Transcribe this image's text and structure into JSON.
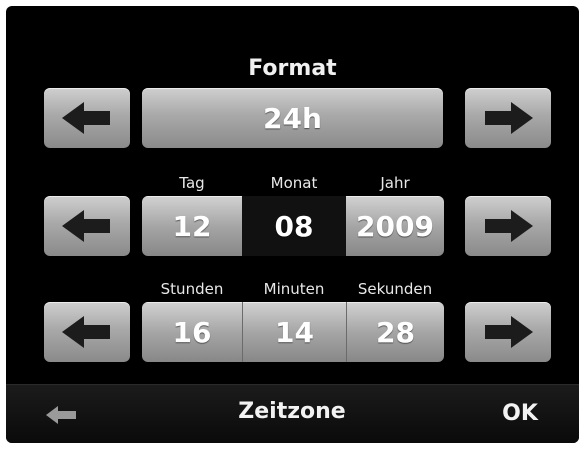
{
  "format": {
    "title": "Format",
    "value": "24h"
  },
  "date": {
    "labels": [
      "Tag",
      "Monat",
      "Jahr"
    ],
    "values": [
      "12",
      "08",
      "2009"
    ],
    "selected": "Monat"
  },
  "time": {
    "labels": [
      "Stunden",
      "Minuten",
      "Sekunden"
    ],
    "values": [
      "16",
      "14",
      "28"
    ]
  },
  "bottom": {
    "back_icon": "back-arrow-icon",
    "zeitzone_label": "Zeitzone",
    "ok_label": "OK"
  },
  "icons": {
    "left": "left-arrow-icon",
    "right": "right-arrow-icon"
  },
  "colors": {
    "background": "#000000",
    "button_light": "#cfcfcf",
    "button_dark": "#8a8a8a",
    "selected_field": "#111111",
    "arrow": "#1c1c1c"
  }
}
